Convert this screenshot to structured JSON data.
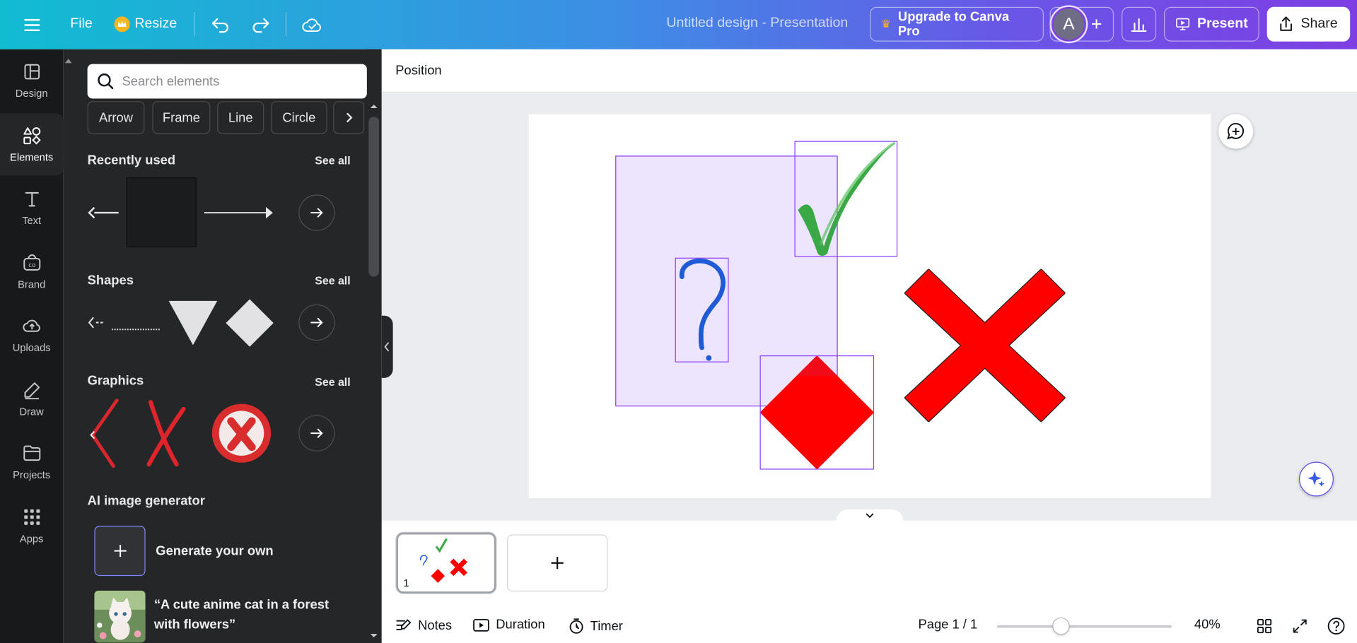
{
  "header": {
    "file_label": "File",
    "resize_label": "Resize",
    "doc_title": "Untitled design - Presentation",
    "upgrade_label": "Upgrade to Canva Pro",
    "avatar_initial": "A",
    "present_label": "Present",
    "share_label": "Share"
  },
  "rail": [
    {
      "label": "Design",
      "icon": "design-icon"
    },
    {
      "label": "Elements",
      "icon": "elements-icon"
    },
    {
      "label": "Text",
      "icon": "text-icon"
    },
    {
      "label": "Brand",
      "icon": "brand-icon"
    },
    {
      "label": "Uploads",
      "icon": "uploads-icon"
    },
    {
      "label": "Draw",
      "icon": "draw-icon"
    },
    {
      "label": "Projects",
      "icon": "projects-icon"
    },
    {
      "label": "Apps",
      "icon": "apps-icon"
    }
  ],
  "panel": {
    "search_placeholder": "Search elements",
    "chips": [
      "Arrow",
      "Frame",
      "Line",
      "Circle"
    ],
    "recently_used": "Recently used",
    "shapes": "Shapes",
    "graphics": "Graphics",
    "see_all": "See all",
    "ai_title": "AI image generator",
    "generate_label": "Generate your own",
    "prompt_example": "“A cute anime cat in a forest with flowers”"
  },
  "toolbar": {
    "position_label": "Position"
  },
  "footer": {
    "notes": "Notes",
    "duration": "Duration",
    "timer": "Timer",
    "page_indicator": "Page 1 / 1",
    "zoom": "40%",
    "page_number": "1"
  },
  "colors": {
    "accent": "#8b3dff",
    "check_green": "#3cb043",
    "question_blue": "#1e5bd8",
    "red": "#ff0000"
  }
}
